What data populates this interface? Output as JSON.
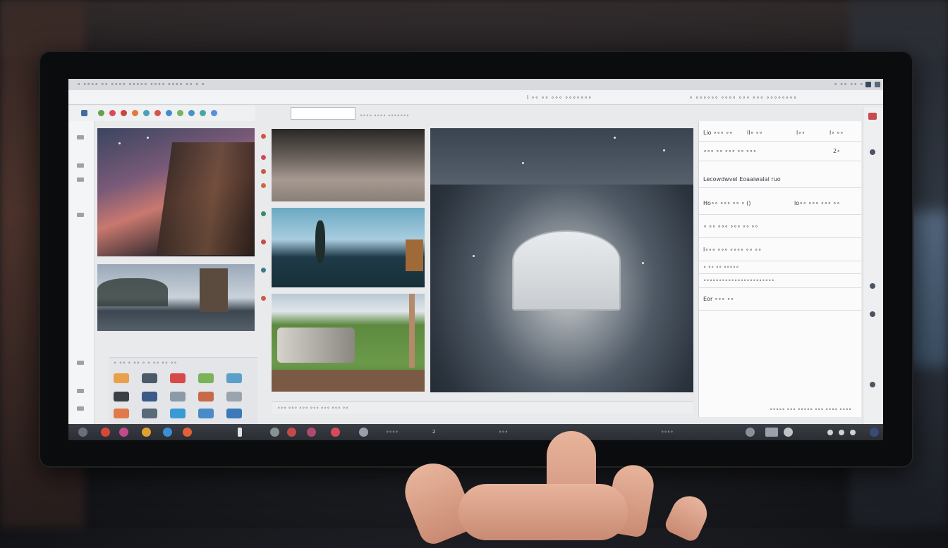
{
  "titlebar": {
    "menu_text": "∘ ∘∘∘∘ ∘∘ ∘∘∘∘ ∘∘∘∘∘ ∘∘∘∘ ∘∘∘∘ ∘∘ ∘ ∘",
    "right_text": "∘ ∘∘ ∘∘ ∘"
  },
  "menubar": {
    "center_text": "l ∘∘ ∘∘ ∘∘∘ ∘∘∘∘∘∘∘",
    "right_text": "∘ ∘∘∘∘∘∘ ∘∘∘∘ ∘∘∘ ∘∘∘ ∘∘∘∘∘∘∘∘"
  },
  "header": {
    "search_placeholder": "",
    "label": "∘∘∘∘ ∘∘∘∘ ∘∘∘∘∘∘∘"
  },
  "right_panel": {
    "rows": [
      {
        "a": "Lio ∘∘∘ ∘∘",
        "b": "ll∘ ∘∘",
        "c": "l∘∘",
        "d": "l∘ ∘∘"
      },
      {
        "a": "∘∘∘ ∘∘ ∘∘∘ ∘∘ ∘∘∘",
        "b": "",
        "c": "",
        "d": "2∘"
      },
      {
        "a": "Lecowdwvel Eoaaiwalal ruo",
        "b": "",
        "c": "",
        "d": ""
      },
      {
        "a": "Ho∘∘ ∘∘∘ ∘∘ ∘ ()",
        "b": "lo∘∘ ∘∘∘ ∘∘∘ ∘∘",
        "c": "",
        "d": ""
      },
      {
        "a": "∘ ∘∘ ∘∘∘ ∘∘∘ ∘∘ ∘∘",
        "b": "",
        "c": "",
        "d": ""
      },
      {
        "a": "l∘∘∘ ∘∘∘ ∘∘∘∘ ∘∘ ∘∘",
        "b": "",
        "c": "",
        "d": ""
      },
      {
        "a": "∘ ∘∘ ∘∘ ∘∘∘∘∘",
        "b": "",
        "c": "",
        "d": ""
      },
      {
        "a": "∘∘∘∘∘∘∘∘∘∘∘∘∘∘∘∘∘∘∘∘∘∘∘",
        "b": "",
        "c": "",
        "d": ""
      },
      {
        "a": "Eor ∘∘∘ ∘∘",
        "b": "",
        "c": "",
        "d": ""
      }
    ],
    "footer": "∘∘∘∘∘ ∘∘∘ ∘∘∘∘∘ ∘∘∘ ∘∘∘∘ ∘∘∘∘"
  },
  "palette": {
    "caption": "∘ ∘∘ ∘ ∘∘ ∘ ∘ ∘∘ ∘∘ ∘∘"
  },
  "status": {
    "text": "∘∘∘ ∘∘∘ ∘∘∘ ∘∘∘ ∘∘∘ ∘∘∘ ∘∘"
  },
  "taskbar": {
    "t1": "∘∘∘∘",
    "t2": "2",
    "t3": "∘∘∘",
    "t4": "∘∘∘∘"
  },
  "colors": {
    "accent": "#d8473a",
    "panel": "#fbfbfc",
    "taskbar": "#2f3238"
  }
}
